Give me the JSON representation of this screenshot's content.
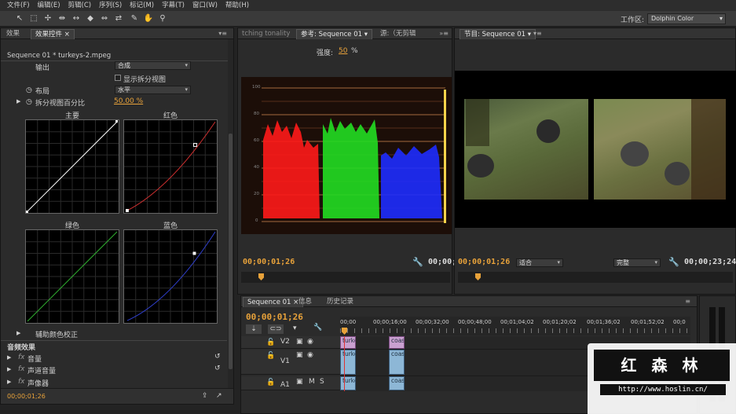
{
  "menu": [
    "文件(F)",
    "编辑(E)",
    "剪辑(C)",
    "序列(S)",
    "标记(M)",
    "字幕(T)",
    "窗口(W)",
    "帮助(H)"
  ],
  "toolbar": {
    "tools": [
      "selection-tool",
      "track-select-tool",
      "ripple-edit-tool",
      "rolling-edit-tool",
      "rate-stretch-tool",
      "razor-tool",
      "slip-tool",
      "slide-tool",
      "pen-tool",
      "hand-tool",
      "zoom-tool"
    ],
    "workspace_label": "工作区:",
    "workspace_value": "Dolphin Color"
  },
  "effects_panel": {
    "tab_effects": "效果",
    "tab_effect_controls": "效果控件",
    "clip_path": "Sequence 01 * turkeys-2.mpeg",
    "output_label": "输出",
    "output_value": "合成",
    "split_view_checkbox": "显示拆分视图",
    "layout_label": "布局",
    "layout_value": "水平",
    "split_percent_label": "拆分视图百分比",
    "split_percent_value": "50.00 %",
    "curves": [
      {
        "label": "主要",
        "color": "#ffffff"
      },
      {
        "label": "红色",
        "color": "#d03030"
      },
      {
        "label": "绿色",
        "color": "#30b030"
      },
      {
        "label": "蓝色",
        "color": "#3040d0"
      }
    ],
    "secondary_color": "辅助颜色校正",
    "audio_effects_header": "音频效果",
    "audio_items": [
      "音量",
      "声道音量",
      "声像器"
    ],
    "timecode": "00;00;01;26"
  },
  "reference_monitor": {
    "tab_left": "tching tonality",
    "tab_ref": "参考: Sequence 01",
    "tab_source": "源:（无剪辑",
    "intensity_label": "强度:",
    "intensity_value": "50",
    "intensity_unit": "%",
    "scope_ticks": [
      "100",
      "80",
      "60",
      "40",
      "20",
      "0"
    ],
    "timecode_left": "00;00;01;26",
    "timecode_right": "00;00;"
  },
  "program_monitor": {
    "tab": "节目: Sequence 01",
    "timecode_left": "00;00;01;26",
    "fit_value": "适合",
    "quality_value": "完整",
    "timecode_right": "00;00;23;24"
  },
  "timeline": {
    "tabs": [
      "Sequence 01",
      "信息",
      "历史记录"
    ],
    "timecode": "00;00;01;26",
    "ruler": [
      "00;00",
      "00;00;16;00",
      "00;00;32;00",
      "00;00;48;00",
      "00;01;04;02",
      "00;01;20;02",
      "00;01;36;02",
      "00;01;52;02",
      "00;0"
    ],
    "tracks": [
      {
        "name": "V2"
      },
      {
        "name": "V1"
      },
      {
        "name": "A1",
        "m": "M",
        "s": "S"
      }
    ],
    "clips": {
      "v2_a": "turke",
      "v2_b": "coas",
      "v1_a": "turke",
      "v1_b": "coas",
      "a1_a": "turke",
      "a1_b": "coas"
    }
  },
  "watermark": {
    "title": "红 森 林",
    "url": "http://www.hoslin.cn/"
  },
  "colors": {
    "accent_orange": "#e8a23a",
    "panel_bg": "#2b2b2b"
  }
}
